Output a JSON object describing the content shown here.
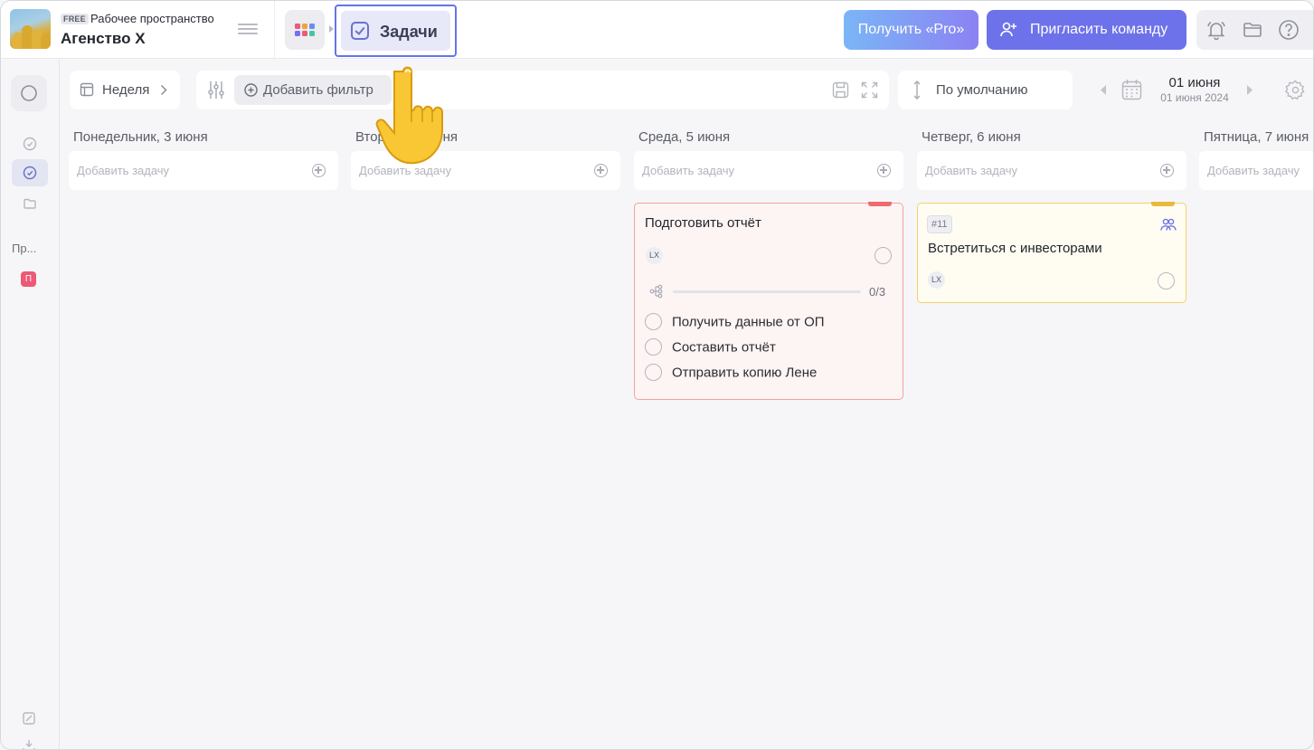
{
  "workspace": {
    "badge": "FREE",
    "label": "Рабочее пространство",
    "name": "Агенство Х"
  },
  "header": {
    "current_tab": "Задачи",
    "pro_button": "Получить «Pro»",
    "invite_button": "Пригласить команду"
  },
  "sidebar": {
    "section_label": "Пр...",
    "project_letter": "П"
  },
  "toolbar": {
    "view_label": "Неделя",
    "add_filter": "Добавить фильтр",
    "sort_label": "По умолчанию",
    "date_main": "01 июня",
    "date_sub": "01 июня 2024"
  },
  "columns": [
    {
      "title": "Понедельник, 3 июня",
      "add_placeholder": "Добавить задачу"
    },
    {
      "title": "Вторник, 4 июня",
      "add_placeholder": "Добавить задачу"
    },
    {
      "title": "Среда, 5 июня",
      "add_placeholder": "Добавить задачу"
    },
    {
      "title": "Четверг, 6 июня",
      "add_placeholder": "Добавить задачу"
    },
    {
      "title": "Пятница, 7 июня",
      "add_placeholder": "Добавить задачу"
    }
  ],
  "cards": {
    "report": {
      "title": "Подготовить отчёт",
      "assignee": "LX",
      "subtasks_progress": "0/3",
      "subtasks": [
        "Получить данные от ОП",
        "Составить отчёт",
        "Отправить копию Лене"
      ],
      "flag_color": "#ef6b6b"
    },
    "investors": {
      "tag": "#11",
      "title": "Встретиться с инвесторами",
      "assignee": "LX",
      "flag_color": "#e8b93a"
    }
  },
  "colors": {
    "accent": "#6d72ea",
    "pro_gradient_start": "#7ab6f6",
    "pro_gradient_end": "#8b82f3",
    "card_red_border": "#f1a2a2",
    "card_yellow_border": "#f1d36a"
  },
  "icons": {
    "bell": "bell-icon",
    "folder": "folder-icon",
    "help": "help-icon",
    "calendar": "calendar-icon",
    "settings": "gear-icon",
    "pointer": "pointing-hand-icon"
  }
}
